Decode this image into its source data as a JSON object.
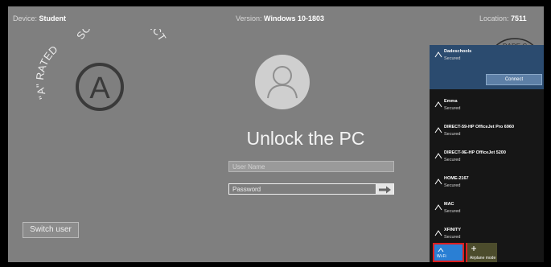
{
  "topbar": {
    "device_label": "Device:",
    "device_value": "Student",
    "version_label": "Version:",
    "version_value": "Windows 10-1803",
    "location_label": "Location:",
    "location_value": "7511"
  },
  "logo": {
    "left_text": "\"A\" RATED",
    "right_text": "SCHOOL DISTRICT",
    "letter": "A"
  },
  "lock": {
    "title": "Unlock the PC",
    "username_placeholder": "User Name",
    "password_placeholder": "Password",
    "switch_user": "Switch user"
  },
  "seal": {
    "text": "DADE C"
  },
  "wifi": {
    "networks": [
      {
        "name": "Dadeschools",
        "status": "Secured"
      },
      {
        "name": "Emma",
        "status": "Secured"
      },
      {
        "name": "DIRECT-59-HP OfficeJet Pro 6960",
        "status": "Secured"
      },
      {
        "name": "DIRECT-9E-HP OfficeJet 5200",
        "status": "Secured"
      },
      {
        "name": "HOME-2167",
        "status": "Secured"
      },
      {
        "name": "MAC",
        "status": "Secured"
      },
      {
        "name": "XFINITY",
        "status": "Secured"
      }
    ],
    "connect_label": "Connect",
    "quick_actions": [
      {
        "label": "Wi-Fi",
        "icon": "wifi-icon"
      },
      {
        "label": "Airplane mode",
        "icon": "airplane-icon"
      }
    ]
  }
}
